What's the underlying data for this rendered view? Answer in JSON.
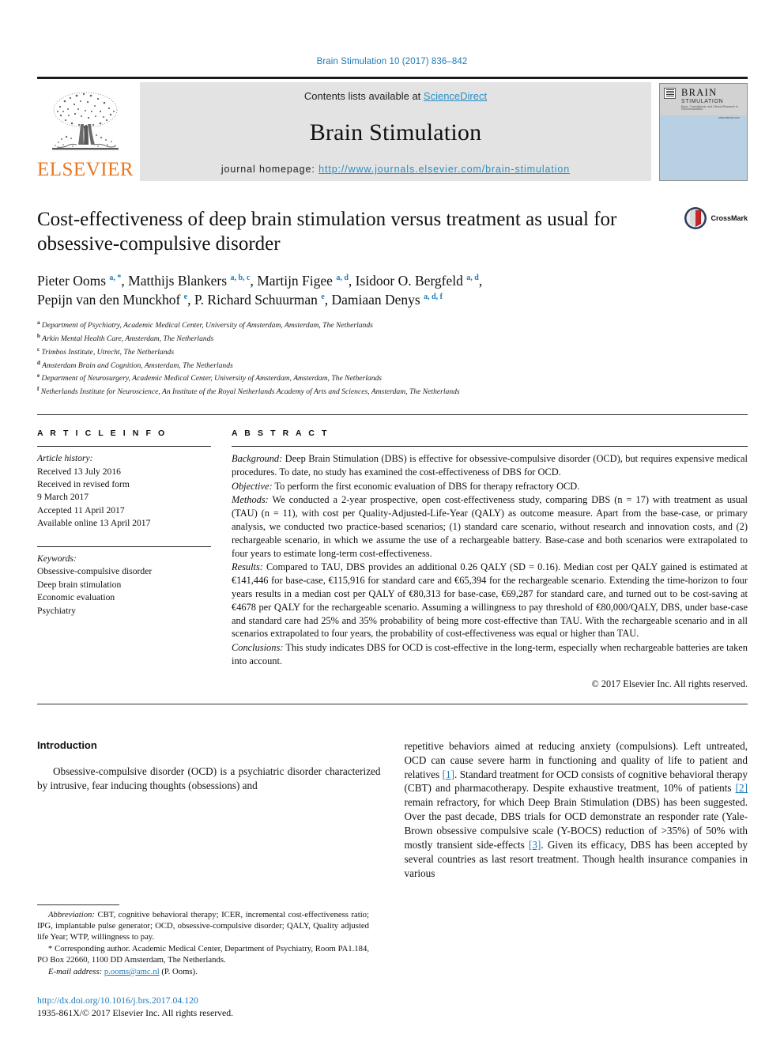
{
  "running_head": "Brain Stimulation 10 (2017) 836–842",
  "masthead": {
    "publisher_name": "ELSEVIER",
    "contents_prefix": "Contents lists available at ",
    "contents_link": "ScienceDirect",
    "journal_name": "Brain Stimulation",
    "homepage_prefix": "journal homepage: ",
    "homepage_link": "http://www.journals.elsevier.com/brain-stimulation",
    "cover": {
      "title_line1": "BRAIN",
      "title_line2": "STIMULATION",
      "title_line3": "Basic, Translational, and Clinical Research in Neuromodulation",
      "title_line4": "www.elsevier.com"
    }
  },
  "article": {
    "title": "Cost-effectiveness of deep brain stimulation versus treatment as usual for obsessive-compulsive disorder",
    "crossmark_label": "CrossMark",
    "authors_line1_parts": [
      {
        "name": "Pieter Ooms ",
        "sup": "a, *"
      },
      {
        "name": ", Matthijs Blankers ",
        "sup": "a, b, c"
      },
      {
        "name": ", Martijn Figee ",
        "sup": "a, d"
      },
      {
        "name": ", Isidoor O. Bergfeld ",
        "sup": "a, d"
      },
      {
        "name": ",",
        "sup": ""
      }
    ],
    "authors_line2_parts": [
      {
        "name": "Pepijn van den Munckhof ",
        "sup": "e"
      },
      {
        "name": ", P. Richard Schuurman ",
        "sup": "e"
      },
      {
        "name": ", Damiaan Denys ",
        "sup": "a, d, f"
      }
    ],
    "affiliations": [
      {
        "marker": "a",
        "text": "Department of Psychiatry, Academic Medical Center, University of Amsterdam, Amsterdam, The Netherlands"
      },
      {
        "marker": "b",
        "text": "Arkin Mental Health Care, Amsterdam, The Netherlands"
      },
      {
        "marker": "c",
        "text": "Trimbos Institute, Utrecht, The Netherlands"
      },
      {
        "marker": "d",
        "text": "Amsterdam Brain and Cognition, Amsterdam, The Netherlands"
      },
      {
        "marker": "e",
        "text": "Department of Neurosurgery, Academic Medical Center, University of Amsterdam, Amsterdam, The Netherlands"
      },
      {
        "marker": "f",
        "text": "Netherlands Institute for Neuroscience, An Institute of the Royal Netherlands Academy of Arts and Sciences, Amsterdam, The Netherlands"
      }
    ]
  },
  "article_info": {
    "heading": "A R T I C L E   I N F O",
    "history_label": "Article history:",
    "history": [
      "Received 13 July 2016",
      "Received in revised form",
      "9 March 2017",
      "Accepted 11 April 2017",
      "Available online 13 April 2017"
    ],
    "keywords_label": "Keywords:",
    "keywords": [
      "Obsessive-compulsive disorder",
      "Deep brain stimulation",
      "Economic evaluation",
      "Psychiatry"
    ]
  },
  "abstract": {
    "heading": "A B S T R A C T",
    "background_label": "Background:",
    "background_text": " Deep Brain Stimulation (DBS) is effective for obsessive-compulsive disorder (OCD), but requires expensive medical procedures. To date, no study has examined the cost-effectiveness of DBS for OCD.",
    "objective_label": "Objective:",
    "objective_text": " To perform the first economic evaluation of DBS for therapy refractory OCD.",
    "methods_label": "Methods:",
    "methods_text": " We conducted a 2-year prospective, open cost-effectiveness study, comparing DBS (n = 17) with treatment as usual (TAU) (n = 11), with cost per Quality-Adjusted-Life-Year (QALY) as outcome measure. Apart from the base-case, or primary analysis, we conducted two practice-based scenarios; (1) standard care scenario, without research and innovation costs, and (2) rechargeable scenario, in which we assume the use of a rechargeable battery. Base-case and both scenarios were extrapolated to four years to estimate long-term cost-effectiveness.",
    "results_label": "Results:",
    "results_text": " Compared to TAU, DBS provides an additional 0.26 QALY (SD = 0.16). Median cost per QALY gained is estimated at €141,446 for base-case, €115,916 for standard care and €65,394 for the rechargeable scenario. Extending the time-horizon to four years results in a median cost per QALY of €80,313 for base-case, €69,287 for standard care, and turned out to be cost-saving at €4678 per QALY for the rechargeable scenario. Assuming a willingness to pay threshold of €80,000/QALY, DBS, under base-case and standard care had 25% and 35% probability of being more cost-effective than TAU. With the rechargeable scenario and in all scenarios extrapolated to four years, the probability of cost-effectiveness was equal or higher than TAU.",
    "conclusions_label": "Conclusions:",
    "conclusions_text": " This study indicates DBS for OCD is cost-effective in the long-term, especially when rechargeable batteries are taken into account.",
    "copyright": "© 2017 Elsevier Inc. All rights reserved."
  },
  "body": {
    "introduction_heading": "Introduction",
    "left_paragraph": "Obsessive-compulsive disorder (OCD) is a psychiatric disorder characterized by intrusive, fear inducing thoughts (obsessions) and",
    "right_paragraph_1": "repetitive behaviors aimed at reducing anxiety (compulsions). Left untreated, OCD can cause severe harm in functioning and quality of life to patient and relatives ",
    "right_ref_1": "[1]",
    "right_paragraph_2": ". Standard treatment for OCD consists of cognitive behavioral therapy (CBT) and pharmacotherapy. Despite exhaustive treatment, 10% of patients ",
    "right_ref_2": "[2]",
    "right_paragraph_3": " remain refractory, for which Deep Brain Stimulation (DBS) has been suggested. Over the past decade, DBS trials for OCD demonstrate an responder rate (Yale-Brown obsessive compulsive scale (Y-BOCS) reduction of >35%) of 50% with mostly transient side-effects ",
    "right_ref_3": "[3]",
    "right_paragraph_4": ". Given its efficacy, DBS has been accepted by several countries as last resort treatment. Though health insurance companies in various"
  },
  "footnotes": {
    "abbreviation_label": "Abbreviation:",
    "abbreviation_text": " CBT, cognitive behavioral therapy; ICER, incremental cost-effectiveness ratio; IPG, implantable pulse generator; OCD, obsessive-compulsive disorder; QALY, Quality adjusted life Year; WTP, willingness to pay.",
    "corresponding_marker": "*",
    "corresponding_text": " Corresponding author. Academic Medical Center, Department of Psychiatry, Room PA1.184, PO Box 22660, 1100 DD Amsterdam, The Netherlands.",
    "email_label": "E-mail address:",
    "email_value": "p.ooms@amc.nl",
    "email_suffix": " (P. Ooms).",
    "doi": "http://dx.doi.org/10.1016/j.brs.2017.04.120",
    "issn_line": "1935-861X/© 2017 Elsevier Inc. All rights reserved."
  },
  "colors": {
    "link_blue": "#1d7bb8",
    "elsevier_orange": "#e87722",
    "band_grey": "#e3e3e3",
    "cover_blue": "#b9cfe2"
  }
}
